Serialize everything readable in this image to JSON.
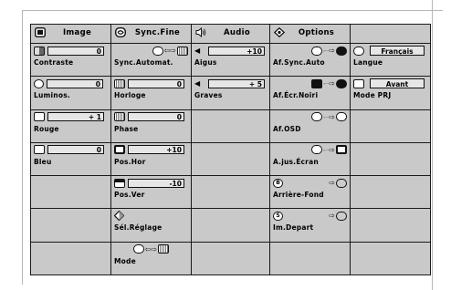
{
  "headers": [
    {
      "icon": "image-icon",
      "label": "Image"
    },
    {
      "icon": "sync-icon",
      "label": "Sync.Fine"
    },
    {
      "icon": "audio-icon",
      "label": "Audio"
    },
    {
      "icon": "options-icon",
      "label": "Options"
    },
    {
      "icon": "",
      "label": ""
    }
  ],
  "image": {
    "contraste": {
      "label": "Contraste",
      "value": "0"
    },
    "luminos": {
      "label": "Luminos.",
      "value": "0"
    },
    "rouge": {
      "label": "Rouge",
      "value": "+ 1"
    },
    "bleu": {
      "label": "Bleu",
      "value": "0"
    }
  },
  "sync": {
    "sync_automat": {
      "label": "Sync.Automat."
    },
    "horloge": {
      "label": "Horloge",
      "value": "0"
    },
    "phase": {
      "label": "Phase",
      "value": "0"
    },
    "pos_hor": {
      "label": "Pos.Hor",
      "value": "+10"
    },
    "pos_ver": {
      "label": "Pos.Ver",
      "value": "-10"
    },
    "sel_reglage": {
      "label": "Sél.Réglage"
    },
    "mode": {
      "label": "Mode"
    }
  },
  "audio": {
    "aigus": {
      "label": "Aigus",
      "value": "+10"
    },
    "graves": {
      "label": "Graves",
      "value": "+ 5"
    }
  },
  "options": {
    "af_sync_auto": {
      "label": "Af.Sync.Auto"
    },
    "af_ecr_noiri": {
      "label": "Af.Écr.Noiri"
    },
    "af_osd": {
      "label": "Af.OSD"
    },
    "ajus_ecran": {
      "label": "A.jus.Écran"
    },
    "arriere_fond": {
      "label": "Arrière-Fond"
    },
    "im_depart": {
      "label": "Im.Depart"
    }
  },
  "extra": {
    "langue": {
      "label": "Langue",
      "value": "Français"
    },
    "mode_prj": {
      "label": "Mode PRJ",
      "value": "Avant"
    }
  },
  "arrow_glyphs": {
    "left_right": "⇦⇨",
    "right": "⇨"
  }
}
